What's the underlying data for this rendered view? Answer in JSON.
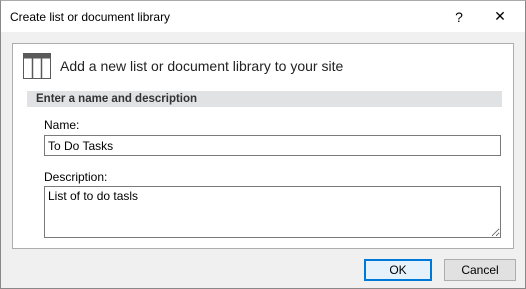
{
  "window": {
    "title": "Create list or document library",
    "help_label": "?",
    "close_label": "✕"
  },
  "header": {
    "icon": "list-table-icon",
    "text": "Add a new list or document library to your site"
  },
  "section": {
    "title": "Enter a name and description"
  },
  "form": {
    "name_label": "Name:",
    "name_value": "To Do Tasks",
    "description_label": "Description:",
    "description_value": "List of to do tasls"
  },
  "buttons": {
    "ok_label": "OK",
    "cancel_label": "Cancel"
  },
  "colors": {
    "accent": "#0078d7",
    "section_bar": "#e1e2e3"
  }
}
